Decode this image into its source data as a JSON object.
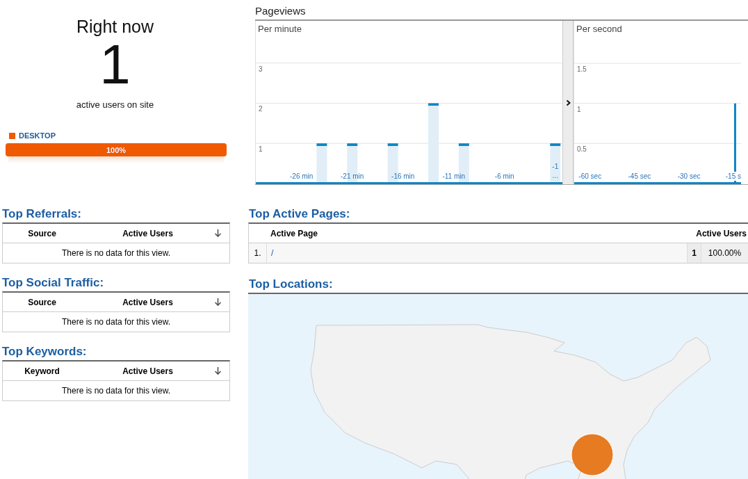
{
  "right_now": {
    "title": "Right now",
    "count": "1",
    "caption": "active users on site"
  },
  "devices": [
    {
      "label": "DESKTOP",
      "color": "#ef5a00",
      "level": 1,
      "reading": "100%"
    }
  ],
  "pageviews": {
    "title": "Pageviews",
    "per_minute": {
      "title": "Per minute",
      "chart_data": {
        "type": "bar",
        "x": [
          -30,
          -29,
          -28,
          -27,
          -26,
          -25,
          -24,
          -23,
          -22,
          -21,
          -20,
          -19,
          -18,
          -17,
          -16,
          -15,
          -14,
          -13,
          -12,
          -11,
          -10,
          -9,
          -8,
          -7,
          -6,
          -5,
          -4,
          -3,
          -2,
          -1
        ],
        "values": [
          0,
          0,
          0,
          0,
          0,
          0,
          1,
          0,
          0,
          1,
          0,
          0,
          0,
          1,
          0,
          0,
          0,
          2,
          0,
          0,
          1,
          0,
          0,
          0,
          0,
          0,
          0,
          0,
          0,
          1
        ],
        "xlim": [
          -30.5,
          -0.3
        ],
        "ylim": [
          0,
          4.05
        ],
        "yticks": [
          1,
          2,
          3
        ],
        "grid": true,
        "xticks": [
          {
            "value": -26,
            "label": "-26 min"
          },
          {
            "value": -21,
            "label": "-21 min"
          },
          {
            "value": -16,
            "label": "-16 min"
          },
          {
            "value": -11,
            "label": "-11 min"
          },
          {
            "value": -6,
            "label": "-6 min"
          },
          {
            "value": -1,
            "label": "-1 ..."
          }
        ]
      }
    },
    "per_second": {
      "title": "Per second",
      "chart_data": {
        "type": "bar",
        "x": [
          -16
        ],
        "values": [
          1
        ],
        "xlim": [
          -64.8,
          -14.2
        ],
        "ylim": [
          0,
          2.03
        ],
        "yticks": [
          0.5,
          1,
          1.5
        ],
        "grid": true,
        "xticks": [
          {
            "value": -60,
            "label": "-60 sec"
          },
          {
            "value": -45,
            "label": "-45 sec"
          },
          {
            "value": -30,
            "label": "-30 sec"
          },
          {
            "value": -15,
            "label": "-15 s"
          }
        ]
      }
    }
  },
  "top_referrals": {
    "title": "Top Referrals:",
    "columns": [
      "Source",
      "Active Users"
    ],
    "empty_message": "There is no data for this view."
  },
  "top_social_traffic": {
    "title": "Top Social Traffic:",
    "columns": [
      "Source",
      "Active Users"
    ],
    "empty_message": "There is no data for this view."
  },
  "top_keywords": {
    "title": "Top Keywords:",
    "columns": [
      "Keyword",
      "Active Users"
    ],
    "empty_message": "There is no data for this view."
  },
  "top_active_pages": {
    "title": "Top Active Pages:",
    "columns": [
      "Active Page",
      "Active Users"
    ],
    "rows": [
      {
        "index": "1.",
        "page": "/",
        "count": "1",
        "share": "100.00%"
      }
    ]
  },
  "top_locations": {
    "title": "Top Locations:"
  }
}
